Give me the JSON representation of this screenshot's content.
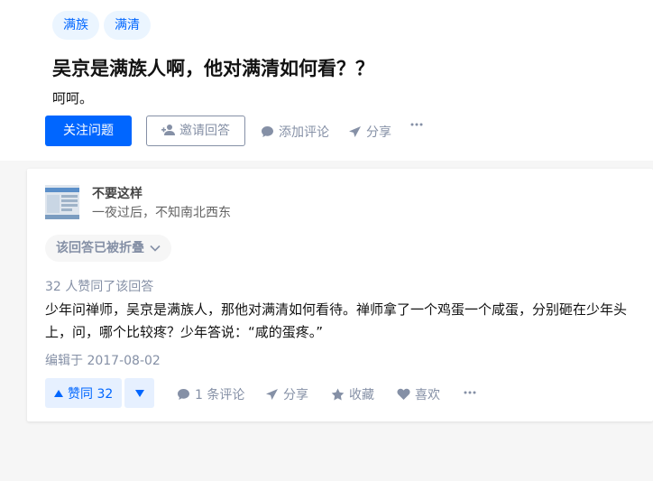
{
  "question": {
    "tags": [
      "满族",
      "满清"
    ],
    "title": "吴京是满族人啊，他对满清如何看？？",
    "detail": "呵呵。",
    "actions": {
      "follow": "关注问题",
      "invite": "邀请回答",
      "comment": "添加评论",
      "share": "分享"
    }
  },
  "answer": {
    "author": {
      "name": "不要这样",
      "bio": "一夜过后，不知南北西东"
    },
    "collapsed_label": "该回答已被折叠",
    "upvote_text": "32 人赞同了该回答",
    "content": "少年问禅师，吴京是满族人，那他对满清如何看待。禅师拿了一个鸡蛋一个咸蛋，分别砸在少年头上，问，哪个比较疼？少年答说：“咸的蛋疼。”",
    "edit_time": "编辑于 2017-08-02",
    "actions": {
      "vote_up": "赞同 32",
      "comments": "1 条评论",
      "share": "分享",
      "collect": "收藏",
      "like": "喜欢"
    }
  },
  "colors": {
    "brand": "#0066ff",
    "meta": "#8590a6"
  }
}
